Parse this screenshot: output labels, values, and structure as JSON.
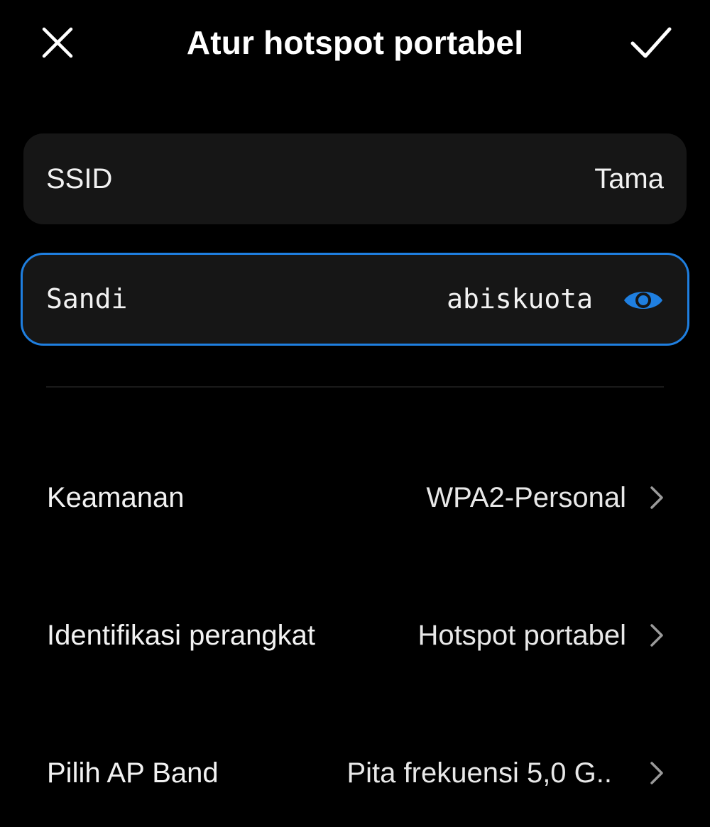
{
  "header": {
    "title": "Atur hotspot portabel",
    "close_icon": "close-icon",
    "confirm_icon": "checkmark-icon"
  },
  "ssid": {
    "label": "SSID",
    "value": "Tama"
  },
  "password": {
    "label": "Sandi",
    "value": "abiskuota",
    "toggle_icon": "eye-icon",
    "focus_color": "#1f7fe0"
  },
  "settings": {
    "security": {
      "label": "Keamanan",
      "value": "WPA2-Personal"
    },
    "device_identity": {
      "label": "Identifikasi perangkat",
      "value": "Hotspot portabel"
    },
    "ap_band": {
      "label": "Pilih AP Band",
      "value": "Pita frekuensi 5,0 G.."
    }
  },
  "theme": {
    "background": "#000000",
    "card": "#161616",
    "accent": "#1f7fe0",
    "text": "#f2f2f2"
  }
}
